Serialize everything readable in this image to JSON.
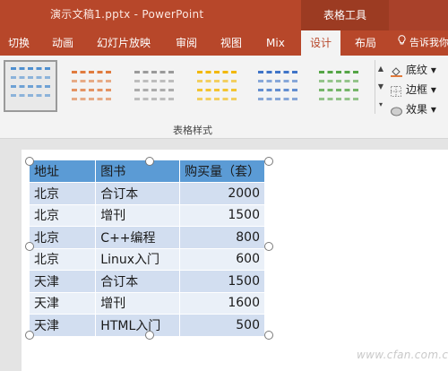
{
  "window": {
    "title": "演示文稿1.pptx - PowerPoint",
    "context_group": "表格工具"
  },
  "tabs": [
    {
      "label": "切换"
    },
    {
      "label": "动画"
    },
    {
      "label": "幻灯片放映"
    },
    {
      "label": "审阅"
    },
    {
      "label": "视图"
    },
    {
      "label": "Mix"
    },
    {
      "label": "设计",
      "active": true
    },
    {
      "label": "布局"
    }
  ],
  "tell_me": "告诉我你",
  "ribbon": {
    "group_label": "表格样式",
    "styles": [
      {
        "name": "table-style-blue-selected",
        "color": "#4f8fd0",
        "selected": true
      },
      {
        "name": "table-style-orange",
        "color": "#e07b3e"
      },
      {
        "name": "table-style-gray",
        "color": "#9a9a9a"
      },
      {
        "name": "table-style-gold",
        "color": "#f2b800"
      },
      {
        "name": "table-style-blue",
        "color": "#3f74c8"
      },
      {
        "name": "table-style-green",
        "color": "#55a546"
      }
    ],
    "options": {
      "shading": "底纹",
      "borders": "边框",
      "effects": "效果"
    }
  },
  "table": {
    "headers": [
      "地址",
      "图书",
      "购买量（套）"
    ],
    "rows": [
      [
        "北京",
        "合订本",
        "2000"
      ],
      [
        "北京",
        "增刊",
        "1500"
      ],
      [
        "北京",
        "C++编程",
        "800"
      ],
      [
        "北京",
        "Linux入门",
        "600"
      ],
      [
        "天津",
        "合订本",
        "1500"
      ],
      [
        "天津",
        "增刊",
        "1600"
      ],
      [
        "天津",
        "HTML入门",
        "500"
      ]
    ]
  },
  "colors": {
    "accent": "#b7472a",
    "header_fill": "#5b9bd5",
    "row_odd": "#d2def0",
    "row_even": "#eaf0f8"
  },
  "watermark": "www.cfan.com.cn"
}
